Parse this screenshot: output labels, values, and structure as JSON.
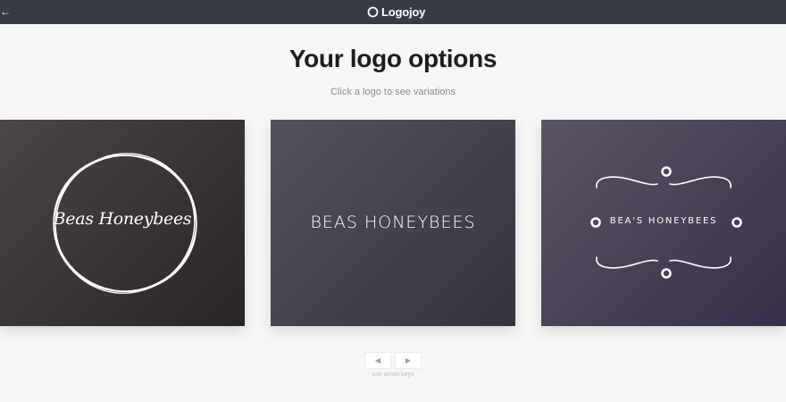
{
  "header": {
    "brand_name": "Logojoy",
    "back_icon": "arrow-left-icon",
    "brand_icon": "ring-icon"
  },
  "main": {
    "title": "Your logo options",
    "subtitle": "Click a logo to see variations",
    "logos": [
      {
        "text": "Beas Honeybees",
        "style": "script-in-woven-circle"
      },
      {
        "text": "BEAS HONEYBEES",
        "style": "thin-caps"
      },
      {
        "text": "BEA'S HONEYBEES",
        "style": "flourish-frame-with-dots"
      }
    ],
    "nav": {
      "prev_label": "◀",
      "next_label": "▶",
      "hint": "use arrow keys"
    }
  },
  "colors": {
    "topbar": "#363b44",
    "page_bg": "#f6f6f6",
    "title": "#1d1d1f",
    "subtitle": "#8a8d94"
  }
}
